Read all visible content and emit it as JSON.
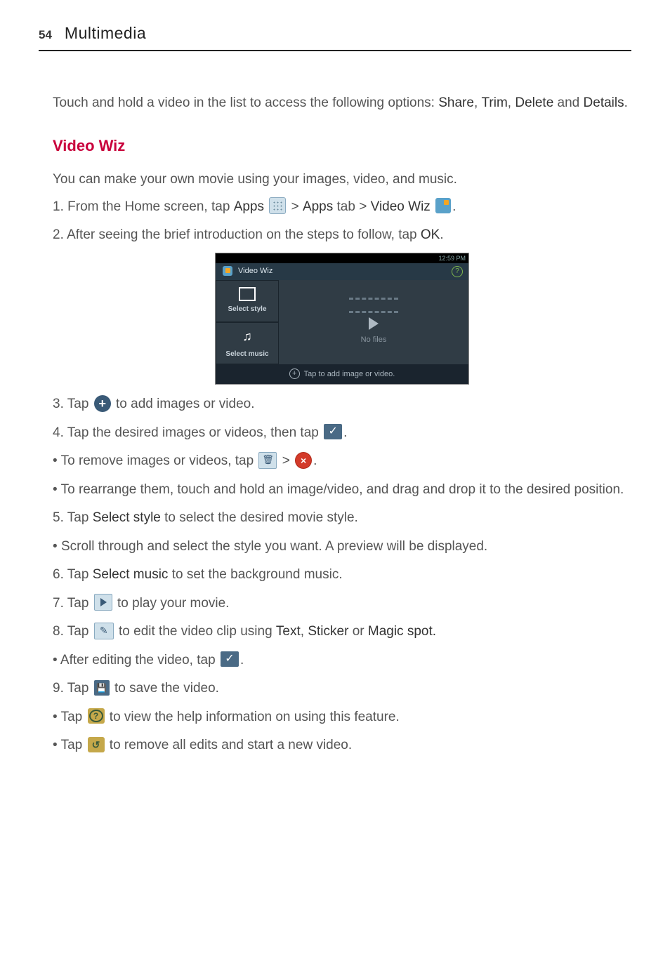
{
  "header": {
    "page_number": "54",
    "section": "Multimedia"
  },
  "intro_para": {
    "lead": "Touch and hold a video in the list to access the following options: ",
    "opt1": "Share",
    "sep1": ", ",
    "opt2": "Trim",
    "sep2": ", ",
    "opt3": "Delete",
    "and": " and ",
    "opt4": "Details",
    "period": "."
  },
  "h3": "Video Wiz",
  "p1": "You can make your own movie using your images, video, and music.",
  "steps": {
    "s1": {
      "t1": "From the Home screen, tap ",
      "apps": "Apps",
      "gt1": " > ",
      "apps_tab": "Apps",
      "tab_word": " tab > ",
      "video_wiz": "Video Wiz",
      "period": "."
    },
    "s2": {
      "t1": "After seeing the brief introduction on the steps to follow, tap ",
      "ok": "OK",
      "period": "."
    },
    "s3": {
      "t1": "Tap ",
      "t2": " to add images or video."
    },
    "s4": {
      "t1": "Tap the desired images or videos, then tap ",
      "t2": "."
    },
    "b_remove": {
      "t1": "To remove images or videos, tap ",
      "gt": " > ",
      "t2": "."
    },
    "b_rearrange": "To rearrange them, touch and hold an image/video, and drag and drop it to the desired position.",
    "s5": {
      "t1": "Tap ",
      "bold": "Select style",
      "t2": " to select the desired movie style."
    },
    "b_scroll": "Scroll through and select the style you want. A preview will be displayed.",
    "s6": {
      "t1": "Tap ",
      "bold": "Select music",
      "t2": " to set the background music."
    },
    "s7": {
      "t1": "Tap ",
      "t2": " to play your movie."
    },
    "s8": {
      "t1": "Tap ",
      "t2": " to edit the video clip using ",
      "b1": "Text",
      "c1": ", ",
      "b2": "Sticker",
      "or": " or ",
      "b3": "Magic spot.",
      "t3": ""
    },
    "b_after_edit": {
      "t1": "After editing the video, tap ",
      "t2": "."
    },
    "s9": {
      "t1": "Tap ",
      "t2": " to save the video."
    },
    "b_help": {
      "t1": "Tap ",
      "t2": " to view the help information on using this feature."
    },
    "b_reset": {
      "t1": "Tap ",
      "t2": " to remove all edits and start a new video."
    }
  },
  "screenshot": {
    "status_time": "12:59 PM",
    "title": "Video Wiz",
    "tile_style": "Select style",
    "tile_music": "Select music",
    "no_files": "No files",
    "footer": "Tap to add image or video."
  }
}
